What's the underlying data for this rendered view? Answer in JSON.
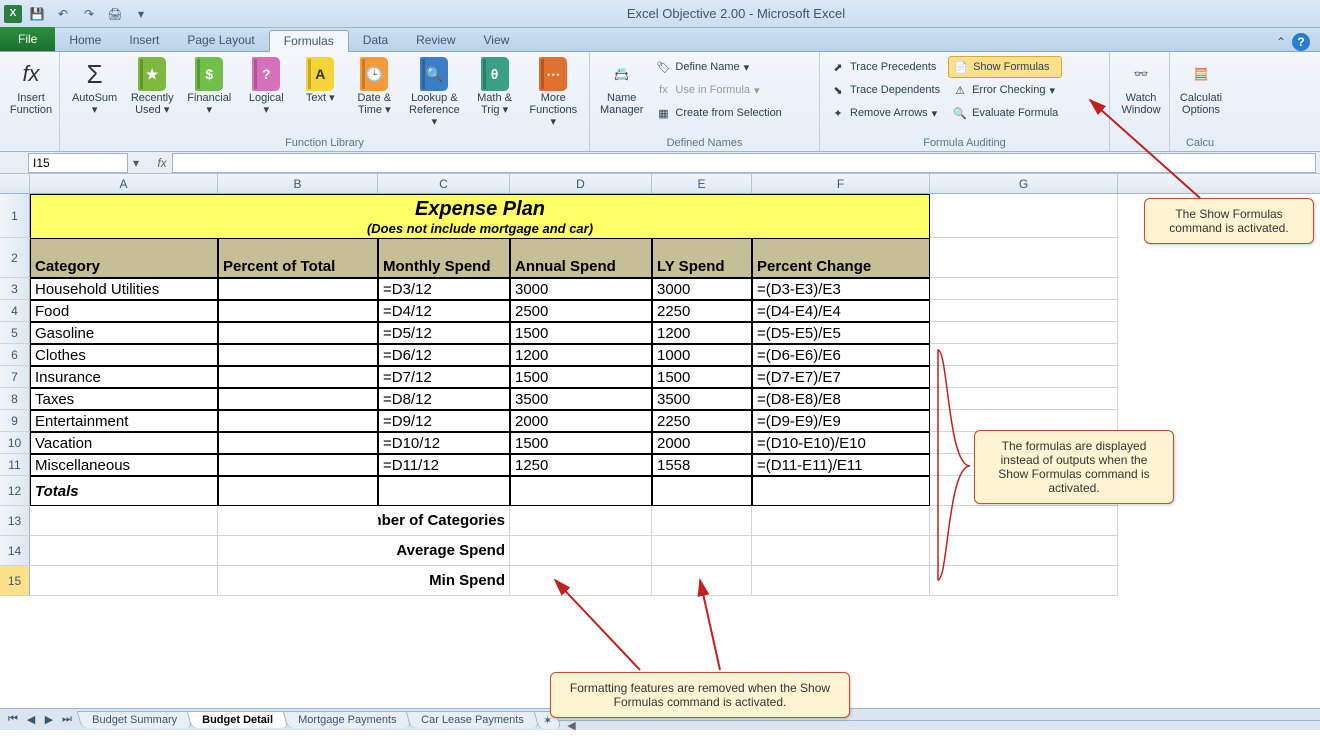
{
  "app": {
    "title": "Excel Objective 2.00  -  Microsoft Excel"
  },
  "tabs": {
    "file": "File",
    "home": "Home",
    "insert": "Insert",
    "pagelayout": "Page Layout",
    "formulas": "Formulas",
    "data": "Data",
    "review": "Review",
    "view": "View"
  },
  "ribbon": {
    "insert_function": "Insert\nFunction",
    "autosum": "AutoSum",
    "recently": "Recently\nUsed",
    "financial": "Financial",
    "logical": "Logical",
    "text": "Text",
    "datetime": "Date &\nTime",
    "lookup": "Lookup &\nReference",
    "math": "Math &\nTrig",
    "more": "More\nFunctions",
    "group_library": "Function Library",
    "name_manager": "Name\nManager",
    "define_name": "Define Name",
    "use_in_formula": "Use in Formula",
    "create_sel": "Create from Selection",
    "group_names": "Defined Names",
    "trace_prec": "Trace Precedents",
    "trace_dep": "Trace Dependents",
    "remove_arrows": "Remove Arrows",
    "show_formulas": "Show Formulas",
    "error_check": "Error Checking",
    "eval_formula": "Evaluate Formula",
    "group_audit": "Formula Auditing",
    "watch": "Watch\nWindow",
    "calc": "Calculati\nOptions",
    "group_calc": "Calcu"
  },
  "namebox": "I15",
  "columns": [
    "A",
    "B",
    "C",
    "D",
    "E",
    "F",
    "G"
  ],
  "sheet": {
    "title": "Expense Plan",
    "subtitle": "(Does not include mortgage and car)",
    "headers": {
      "A": "Category",
      "B": "Percent of Total",
      "C": "Monthly Spend",
      "D": "Annual Spend",
      "E": "LY Spend",
      "F": "Percent Change"
    },
    "rows": [
      {
        "A": "Household Utilities",
        "B": "",
        "C": "=D3/12",
        "D": "3000",
        "E": "3000",
        "F": "=(D3-E3)/E3"
      },
      {
        "A": "Food",
        "B": "",
        "C": "=D4/12",
        "D": "2500",
        "E": "2250",
        "F": "=(D4-E4)/E4"
      },
      {
        "A": "Gasoline",
        "B": "",
        "C": "=D5/12",
        "D": "1500",
        "E": "1200",
        "F": "=(D5-E5)/E5"
      },
      {
        "A": "Clothes",
        "B": "",
        "C": "=D6/12",
        "D": "1200",
        "E": "1000",
        "F": "=(D6-E6)/E6"
      },
      {
        "A": "Insurance",
        "B": "",
        "C": "=D7/12",
        "D": "1500",
        "E": "1500",
        "F": "=(D7-E7)/E7"
      },
      {
        "A": "Taxes",
        "B": "",
        "C": "=D8/12",
        "D": "3500",
        "E": "3500",
        "F": "=(D8-E8)/E8"
      },
      {
        "A": "Entertainment",
        "B": "",
        "C": "=D9/12",
        "D": "2000",
        "E": "2250",
        "F": "=(D9-E9)/E9"
      },
      {
        "A": "Vacation",
        "B": "",
        "C": "=D10/12",
        "D": "1500",
        "E": "2000",
        "F": "=(D10-E10)/E10"
      },
      {
        "A": "Miscellaneous",
        "B": "",
        "C": "=D11/12",
        "D": "1250",
        "E": "1558",
        "F": "=(D11-E11)/E11"
      }
    ],
    "totals": "Totals",
    "stats": {
      "r13": "Number of Categories",
      "r14": "Average Spend",
      "r15": "Min Spend"
    }
  },
  "sheets": [
    "Budget Summary",
    "Budget Detail",
    "Mortgage Payments",
    "Car Lease Payments"
  ],
  "callouts": {
    "c1": "The Show Formulas command is activated.",
    "c2": "The formulas are displayed instead of outputs when the Show Formulas command is activated.",
    "c3": "Formatting features are removed when the Show Formulas command is activated."
  }
}
